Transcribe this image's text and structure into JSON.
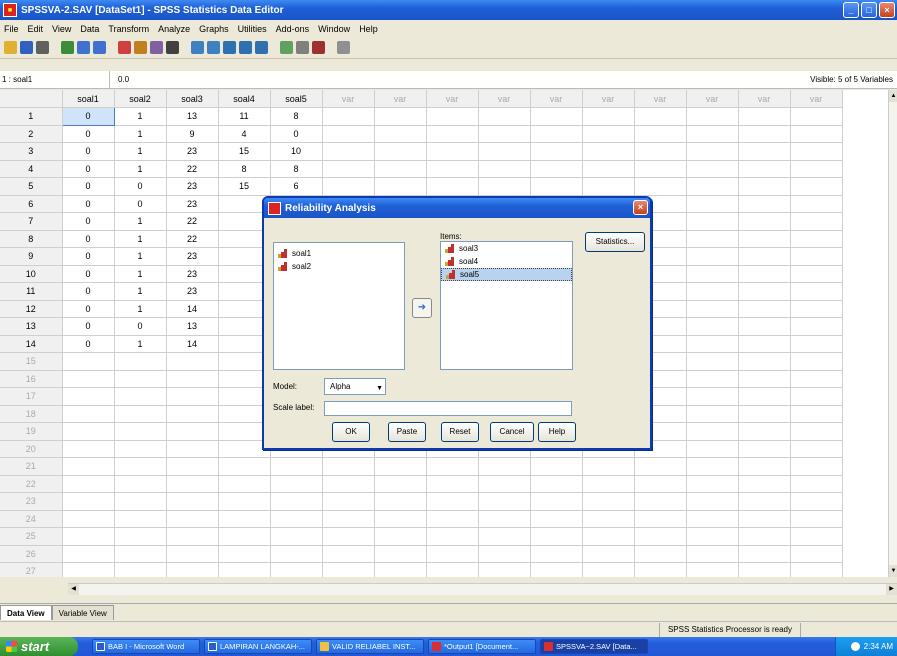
{
  "window": {
    "title": "SPSSVA-2.SAV [DataSet1] - SPSS Statistics Data Editor",
    "min": "_",
    "max": "□",
    "close": "×"
  },
  "menu": [
    "File",
    "Edit",
    "View",
    "Data",
    "Transform",
    "Analyze",
    "Graphs",
    "Utilities",
    "Add-ons",
    "Window",
    "Help"
  ],
  "toolbar_icons": [
    "open-icon",
    "save-icon",
    "print-icon",
    "dialog-recall-icon",
    "undo-icon",
    "redo-icon",
    "goto-case-icon",
    "goto-variable-icon",
    "variables-icon",
    "find-icon",
    "insert-cases-icon",
    "insert-variable-icon",
    "split-file-icon",
    "weight-cases-icon",
    "select-cases-icon",
    "value-labels-icon",
    "use-sets-icon",
    "show-all-icon",
    "spell-icon"
  ],
  "cellbar": {
    "ref": "1 : soal1",
    "value": "0.0",
    "visible": "Visible: 5 of 5 Variables"
  },
  "grid": {
    "columns": [
      "soal1",
      "soal2",
      "soal3",
      "soal4",
      "soal5",
      "var",
      "var",
      "var",
      "var",
      "var",
      "var",
      "var",
      "var",
      "var",
      "var"
    ],
    "rows": [
      [
        "0",
        "1",
        "13",
        "11",
        "8"
      ],
      [
        "0",
        "1",
        "9",
        "4",
        "0"
      ],
      [
        "0",
        "1",
        "23",
        "15",
        "10"
      ],
      [
        "0",
        "1",
        "22",
        "8",
        "8"
      ],
      [
        "0",
        "0",
        "23",
        "15",
        "6"
      ],
      [
        "0",
        "0",
        "23",
        "",
        ""
      ],
      [
        "0",
        "1",
        "22",
        "",
        ""
      ],
      [
        "0",
        "1",
        "22",
        "",
        ""
      ],
      [
        "0",
        "1",
        "23",
        "",
        ""
      ],
      [
        "0",
        "1",
        "23",
        "",
        ""
      ],
      [
        "0",
        "1",
        "23",
        "",
        ""
      ],
      [
        "0",
        "1",
        "14",
        "",
        ""
      ],
      [
        "0",
        "0",
        "13",
        "",
        ""
      ],
      [
        "0",
        "1",
        "14",
        "",
        ""
      ]
    ],
    "total_rows": 27
  },
  "dialog": {
    "title": "Reliability Analysis",
    "close": "×",
    "source_vars": [
      "soal1",
      "soal2"
    ],
    "items_label": "Items:",
    "items": [
      "soal3",
      "soal4",
      "soal5"
    ],
    "move_arrow": "➜",
    "statistics": "Statistics...",
    "model_label": "Model:",
    "model_value": "Alpha",
    "scale_label": "Scale label:",
    "buttons": {
      "ok": "OK",
      "paste": "Paste",
      "reset": "Reset",
      "cancel": "Cancel",
      "help": "Help"
    }
  },
  "tabs": {
    "data_view": "Data View",
    "variable_view": "Variable View"
  },
  "status": "SPSS Statistics  Processor is ready",
  "taskbar": {
    "start": "start",
    "tasks": [
      "BAB I - Microsoft Word",
      "LAMPIRAN LANGKAH-...",
      "VALID RELIABEL INST...",
      "*Output1 [Document...",
      "SPSSVA~2.SAV [Data..."
    ],
    "clock": "2:34 AM"
  }
}
